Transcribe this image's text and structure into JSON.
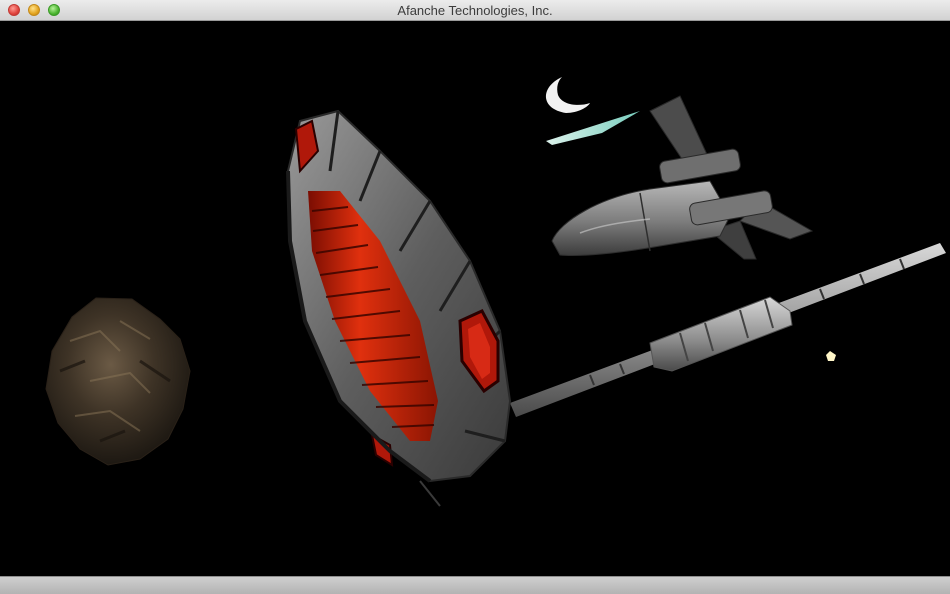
{
  "window": {
    "title": "Afanche Technologies, Inc."
  },
  "scene": {
    "objects": [
      "asteroid",
      "stargate-ring",
      "spaceship",
      "space-station-rod",
      "moon-crescent",
      "light-streak",
      "star"
    ]
  }
}
